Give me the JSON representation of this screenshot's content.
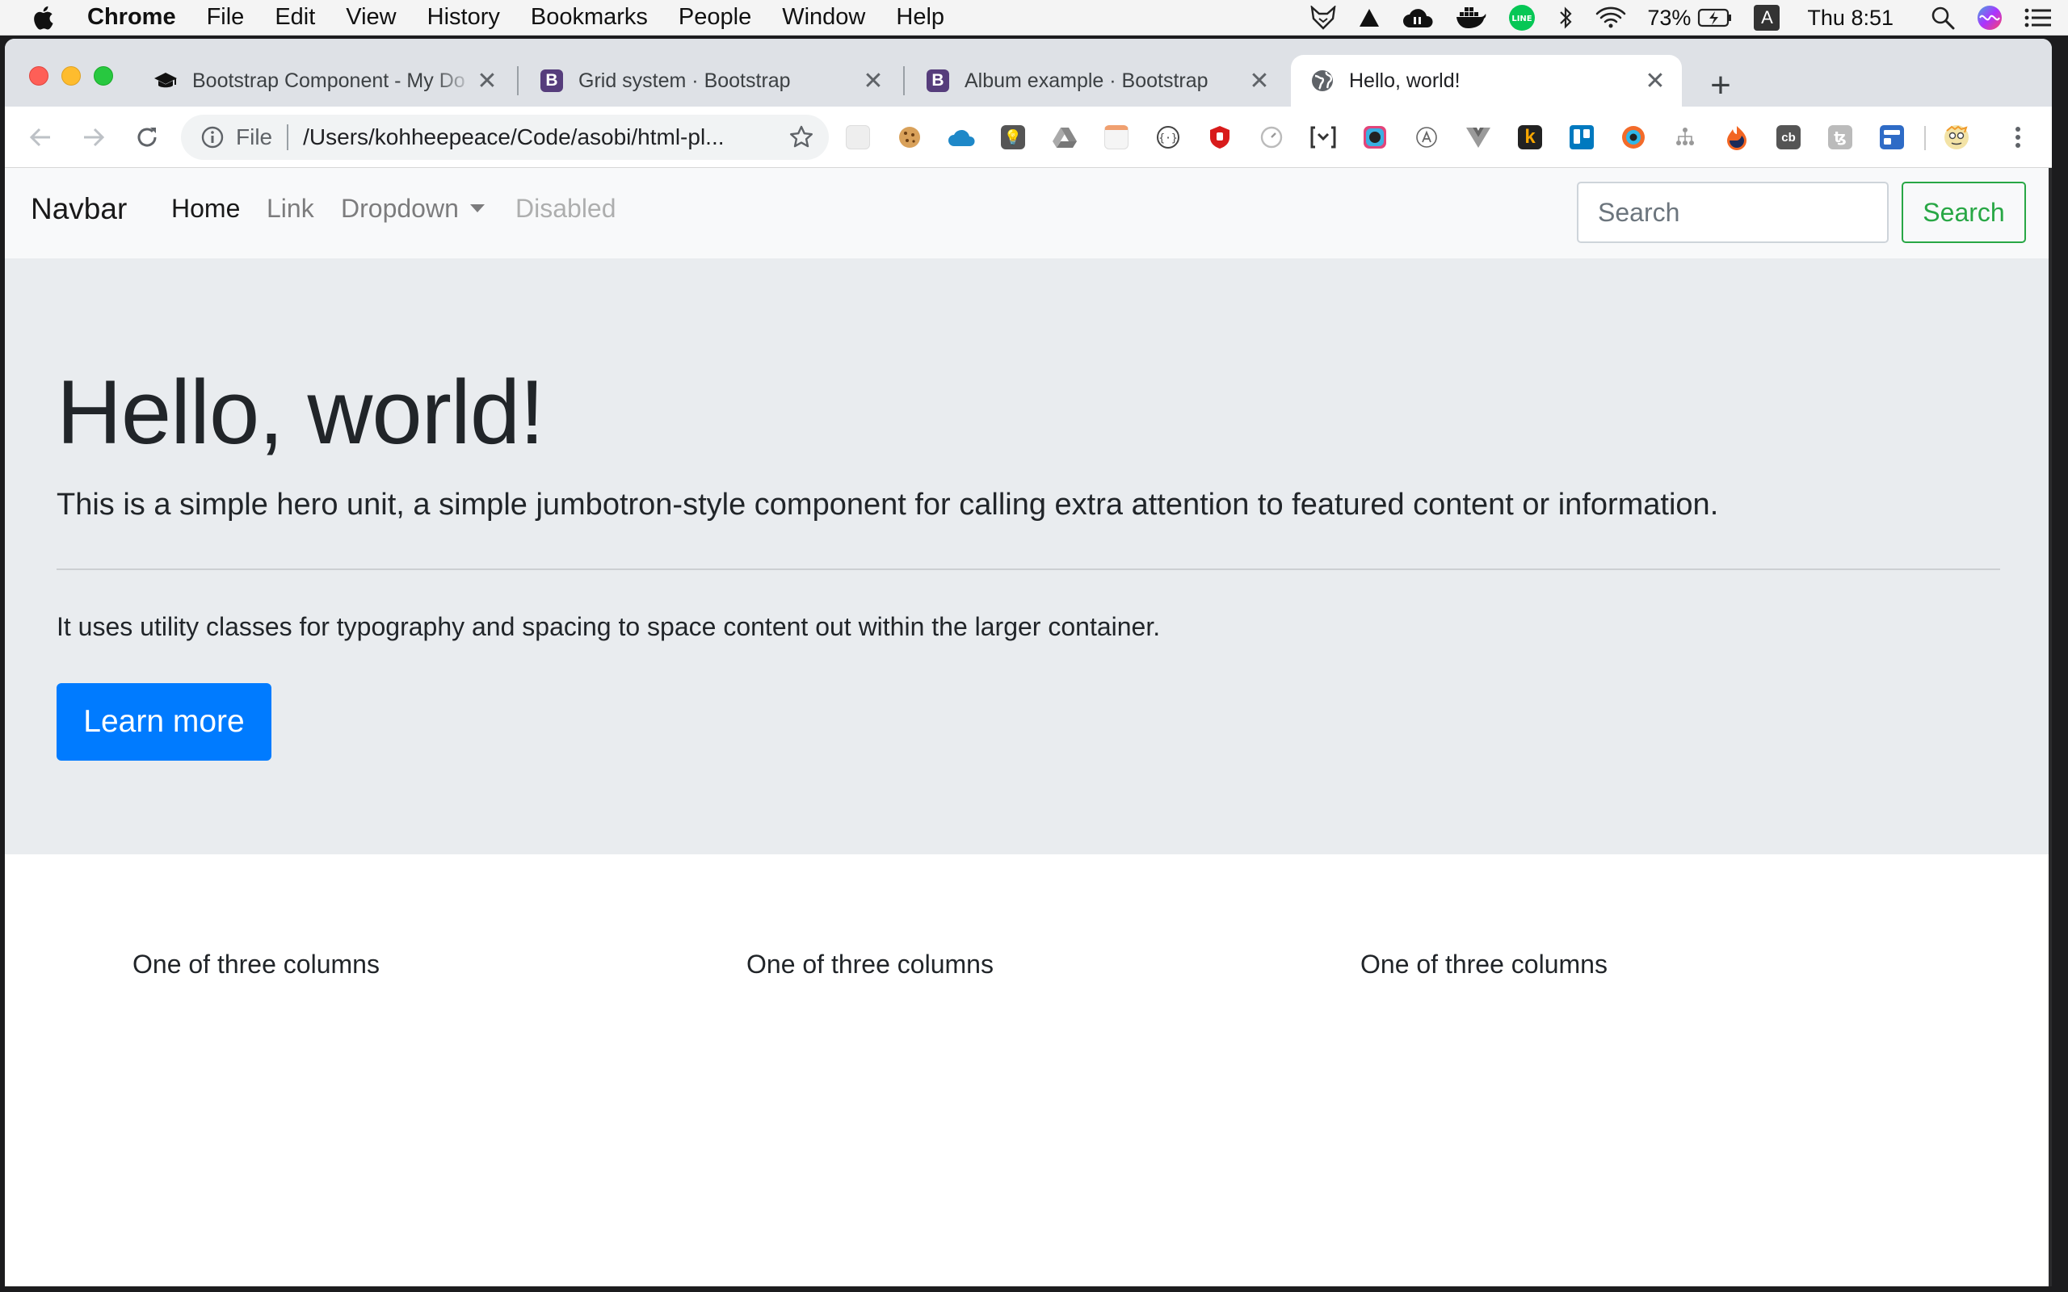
{
  "menubar": {
    "app": "Chrome",
    "items": [
      "File",
      "Edit",
      "View",
      "History",
      "Bookmarks",
      "People",
      "Window",
      "Help"
    ],
    "battery": "73%",
    "input_source": "A",
    "clock": "Thu 8:51"
  },
  "tabs": [
    {
      "title": "Bootstrap Component - My Do",
      "favicon": "graduation-cap-icon"
    },
    {
      "title": "Grid system · Bootstrap",
      "favicon": "bootstrap-icon",
      "favicon_letter": "B"
    },
    {
      "title": "Album example · Bootstrap",
      "favicon": "bootstrap-icon",
      "favicon_letter": "B"
    },
    {
      "title": "Hello, world!",
      "favicon": "globe-icon",
      "active": true
    }
  ],
  "toolbar": {
    "scheme": "File",
    "url": "/Users/kohheepeace/Code/asobi/html-pl..."
  },
  "extensions": {
    "k_letter": "k",
    "cb_letter": "cb"
  },
  "page": {
    "navbar": {
      "brand": "Navbar",
      "links": {
        "home": "Home",
        "link": "Link",
        "dropdown": "Dropdown",
        "disabled": "Disabled"
      },
      "search_placeholder": "Search",
      "search_button": "Search"
    },
    "jumbotron": {
      "heading": "Hello, world!",
      "lead": "This is a simple hero unit, a simple jumbotron-style component for calling extra attention to featured content or information.",
      "body": "It uses utility classes for typography and spacing to space content out within the larger container.",
      "button": "Learn more"
    },
    "columns": [
      "One of three columns",
      "One of three columns",
      "One of three columns"
    ]
  },
  "colors": {
    "primary": "#007bff",
    "success": "#28a745",
    "jumbotron_bg": "#e9ecef",
    "navbar_bg": "#f8f9fa",
    "bootstrap_purple": "#563d7c"
  }
}
